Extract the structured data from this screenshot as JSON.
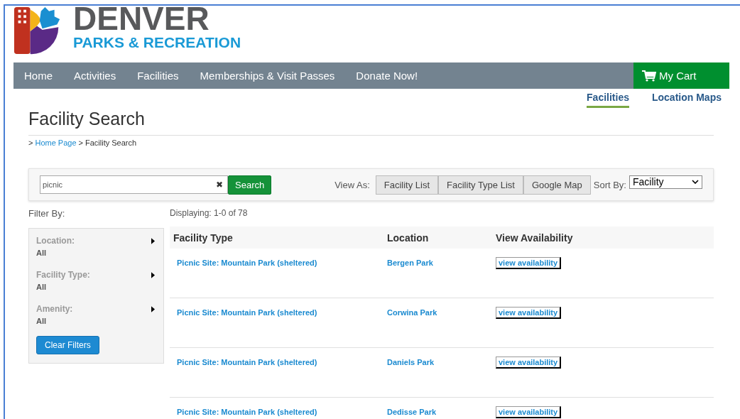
{
  "logo": {
    "title": "DENVER",
    "subtitle": "PARKS & RECREATION"
  },
  "nav": {
    "items": [
      "Home",
      "Activities",
      "Facilities",
      "Memberships & Visit Passes",
      "Donate Now!"
    ],
    "cart": "My Cart"
  },
  "subtabs": [
    {
      "label": "Facilities",
      "selected": true
    },
    {
      "label": "Location Maps",
      "selected": false
    }
  ],
  "page_title": "Facility Search",
  "breadcrumb": {
    "prefix": ">",
    "link": "Home Page",
    "separator": ">",
    "current": "Facility Search"
  },
  "search": {
    "value": "picnic",
    "clear": "✖",
    "button": "Search"
  },
  "view_as": {
    "label": "View As:",
    "buttons": [
      "Facility List",
      "Facility Type List",
      "Google Map"
    ]
  },
  "sort_by": {
    "label": "Sort By:",
    "value": "Facility"
  },
  "filter": {
    "heading": "Filter By:",
    "items": [
      {
        "label": "Location:",
        "value": "All"
      },
      {
        "label": "Facility Type:",
        "value": "All"
      },
      {
        "label": "Amenity:",
        "value": "All"
      }
    ],
    "clear_button": "Clear Filters"
  },
  "results": {
    "displaying": "Displaying: 1-0 of 78",
    "columns": [
      "Facility Type",
      "Location",
      "View Availability"
    ],
    "rows": [
      {
        "facility_type": "Picnic Site: Mountain Park (sheltered)",
        "location": "Bergen Park",
        "action": "view availability"
      },
      {
        "facility_type": "Picnic Site: Mountain Park (sheltered)",
        "location": "Corwina Park",
        "action": "view availability"
      },
      {
        "facility_type": "Picnic Site: Mountain Park (sheltered)",
        "location": "Daniels Park",
        "action": "view availability"
      },
      {
        "facility_type": "Picnic Site: Mountain Park (sheltered)",
        "location": "Dedisse Park",
        "action": "view availability"
      }
    ]
  }
}
